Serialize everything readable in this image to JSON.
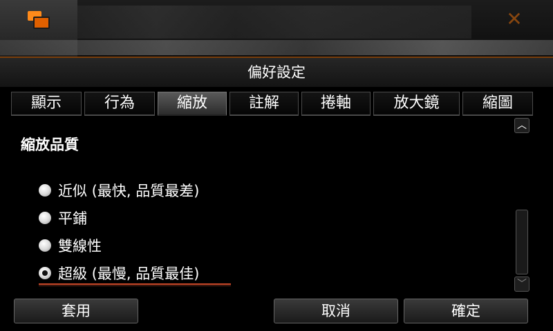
{
  "dialog": {
    "title": "偏好設定"
  },
  "tabs": [
    {
      "label": "顯示"
    },
    {
      "label": "行為"
    },
    {
      "label": "縮放",
      "active": true
    },
    {
      "label": "註解"
    },
    {
      "label": "捲軸"
    },
    {
      "label": "放大鏡"
    },
    {
      "label": "縮圖"
    }
  ],
  "section": {
    "title": "縮放品質"
  },
  "options": [
    {
      "label": "近似 (最快, 品質最差)",
      "checked": false
    },
    {
      "label": "平鋪",
      "checked": false
    },
    {
      "label": "雙線性",
      "checked": false
    },
    {
      "label": "超級 (最慢, 品質最佳)",
      "checked": true
    }
  ],
  "buttons": {
    "apply": "套用",
    "cancel": "取消",
    "ok": "確定"
  },
  "icons": {
    "app": "app-windows-icon",
    "close": "close-icon",
    "scroll_up": "chevron-up-icon",
    "scroll_down": "chevron-down-icon"
  },
  "colors": {
    "accent": "#ff8a1a",
    "focus_underline": "#d04a2a"
  }
}
